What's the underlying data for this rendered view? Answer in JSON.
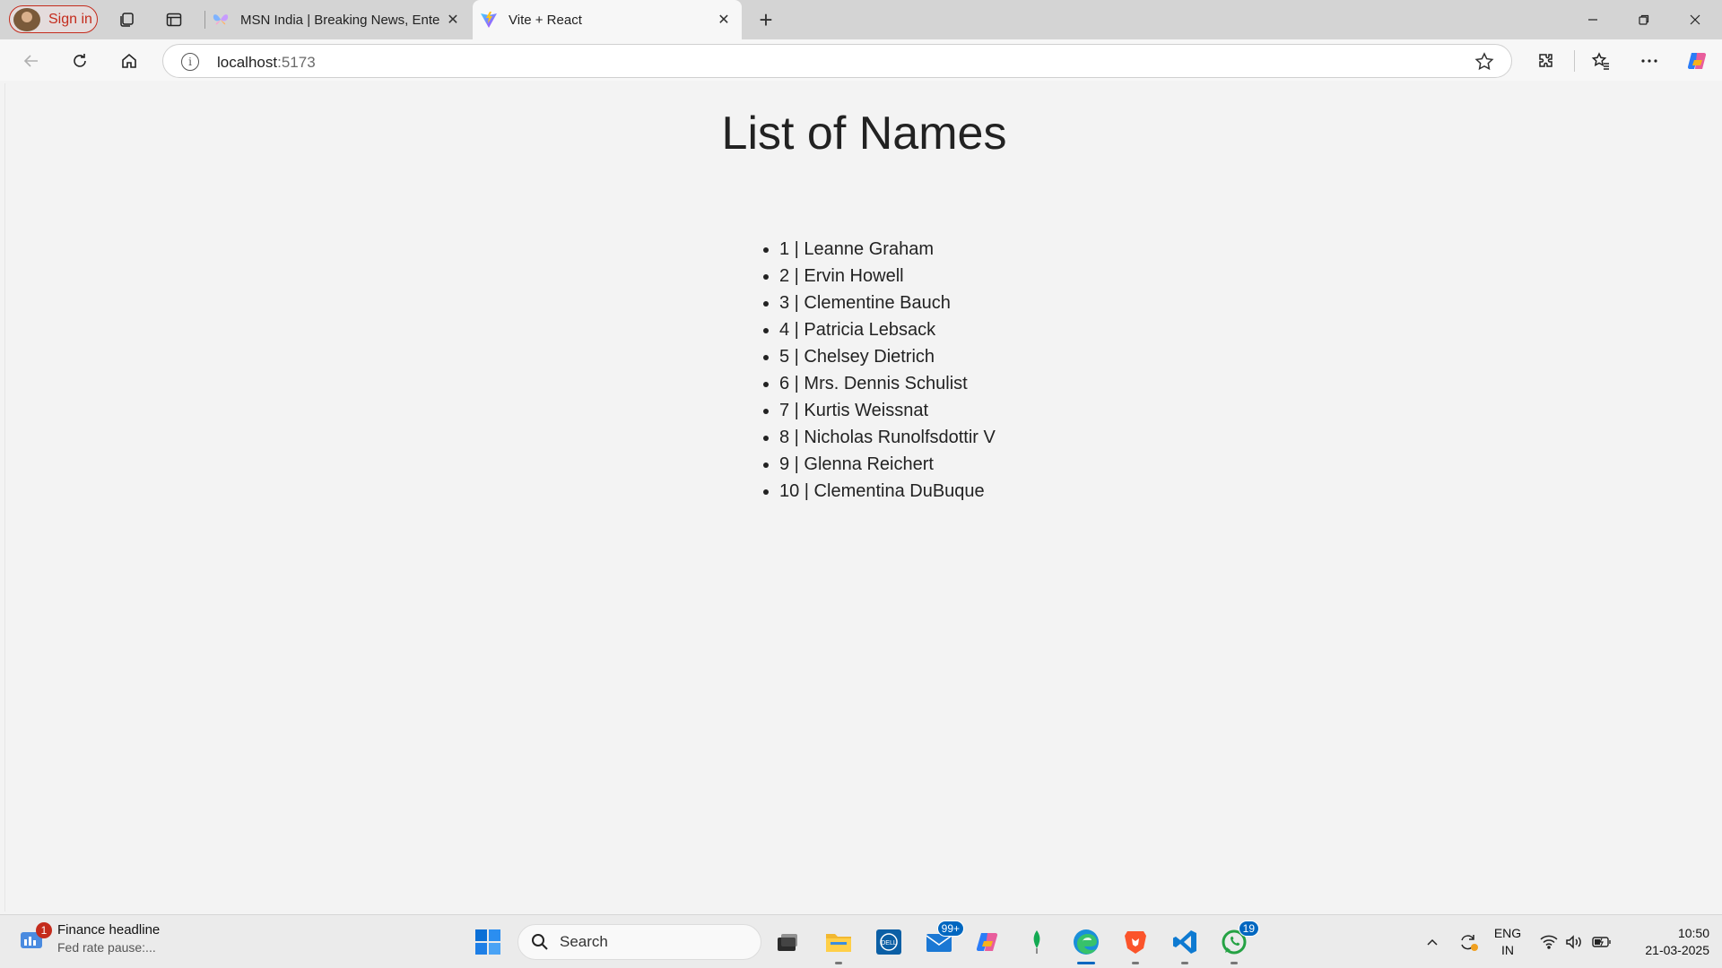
{
  "browser": {
    "signin_label": "Sign in",
    "tabs": [
      {
        "title": "MSN India | Breaking News, Entertainment",
        "active": false
      },
      {
        "title": "Vite + React",
        "active": true
      }
    ],
    "address": {
      "host": "localhost",
      "port": ":5173"
    }
  },
  "page": {
    "title": "List of Names",
    "names": [
      "1 | Leanne Graham",
      "2 | Ervin Howell",
      "3 | Clementine Bauch",
      "4 | Patricia Lebsack",
      "5 | Chelsey Dietrich",
      "6 | Mrs. Dennis Schulist",
      "7 | Kurtis Weissnat",
      "8 | Nicholas Runolfsdottir V",
      "9 | Glenna Reichert",
      "10 | Clementina DuBuque"
    ]
  },
  "taskbar": {
    "widget": {
      "badge": "1",
      "title": "Finance headline",
      "subtitle": "Fed rate pause:..."
    },
    "search_label": "Search",
    "mail_badge": "99+",
    "whatsapp_badge": "19",
    "language": {
      "line1": "ENG",
      "line2": "IN"
    },
    "clock": {
      "time": "10:50",
      "date": "21-03-2025"
    }
  },
  "colors": {
    "accent": "#0067c0",
    "signin_red": "#c42b1c",
    "page_bg": "#f3f3f3",
    "tabbar_bg": "#d4d4d4"
  }
}
